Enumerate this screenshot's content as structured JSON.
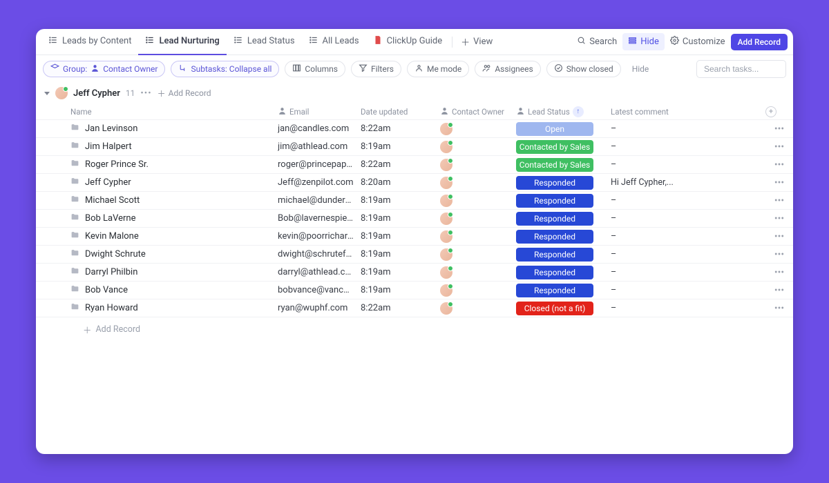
{
  "tabs": [
    {
      "label": "Leads by Content",
      "active": false
    },
    {
      "label": "Lead Nurturing",
      "active": true
    },
    {
      "label": "Lead Status",
      "active": false
    },
    {
      "label": "All Leads",
      "active": false
    },
    {
      "label": "ClickUp Guide",
      "active": false
    }
  ],
  "view_label": "View",
  "toolbar": {
    "search": "Search",
    "hide": "Hide",
    "customize": "Customize",
    "add_record": "Add Record"
  },
  "chips": {
    "group_prefix": "Group:",
    "group_value": "Contact Owner",
    "subtasks": "Subtasks: Collapse all",
    "columns": "Columns",
    "filters": "Filters",
    "me_mode": "Me mode",
    "assignees": "Assignees",
    "show_closed": "Show closed",
    "hide": "Hide"
  },
  "search_placeholder": "Search tasks...",
  "group": {
    "owner_name": "Jeff Cypher",
    "count": "11",
    "add_record": "Add Record"
  },
  "columns": {
    "name": "Name",
    "email": "Email",
    "date_updated": "Date updated",
    "contact_owner": "Contact Owner",
    "lead_status": "Lead Status",
    "latest_comment": "Latest comment"
  },
  "rows": [
    {
      "name": "Jan Levinson",
      "email": "jan@candles.com",
      "date": "8:22am",
      "status": "Open",
      "status_class": "status-open",
      "comment": "–"
    },
    {
      "name": "Jim Halpert",
      "email": "jim@athlead.com",
      "date": "8:19am",
      "status": "Contacted by Sales",
      "status_class": "status-contacted",
      "comment": "–"
    },
    {
      "name": "Roger Prince Sr.",
      "email": "roger@princepaper...",
      "date": "8:22am",
      "status": "Contacted by Sales",
      "status_class": "status-contacted",
      "comment": "–"
    },
    {
      "name": "Jeff Cypher",
      "email": "Jeff@zenpilot.com",
      "date": "8:20am",
      "status": "Responded",
      "status_class": "status-responded",
      "comment": "Hi Jeff Cypher,..."
    },
    {
      "name": "Michael Scott",
      "email": "michael@dundermi...",
      "date": "8:19am",
      "status": "Responded",
      "status_class": "status-responded",
      "comment": "–"
    },
    {
      "name": "Bob LaVerne",
      "email": "Bob@lavernespies...",
      "date": "8:19am",
      "status": "Responded",
      "status_class": "status-responded",
      "comment": "–"
    },
    {
      "name": "Kevin Malone",
      "email": "kevin@poorrichard...",
      "date": "8:19am",
      "status": "Responded",
      "status_class": "status-responded",
      "comment": "–"
    },
    {
      "name": "Dwight Schrute",
      "email": "dwight@schrutefar...",
      "date": "8:19am",
      "status": "Responded",
      "status_class": "status-responded",
      "comment": "–"
    },
    {
      "name": "Darryl Philbin",
      "email": "darryl@athlead.com",
      "date": "8:19am",
      "status": "Responded",
      "status_class": "status-responded",
      "comment": "–"
    },
    {
      "name": "Bob Vance",
      "email": "bobvance@vancer...",
      "date": "8:19am",
      "status": "Responded",
      "status_class": "status-responded",
      "comment": "–"
    },
    {
      "name": "Ryan Howard",
      "email": "ryan@wuphf.com",
      "date": "8:22am",
      "status": "Closed (not a fit)",
      "status_class": "status-closed",
      "comment": "–"
    }
  ],
  "footer_add": "Add Record"
}
